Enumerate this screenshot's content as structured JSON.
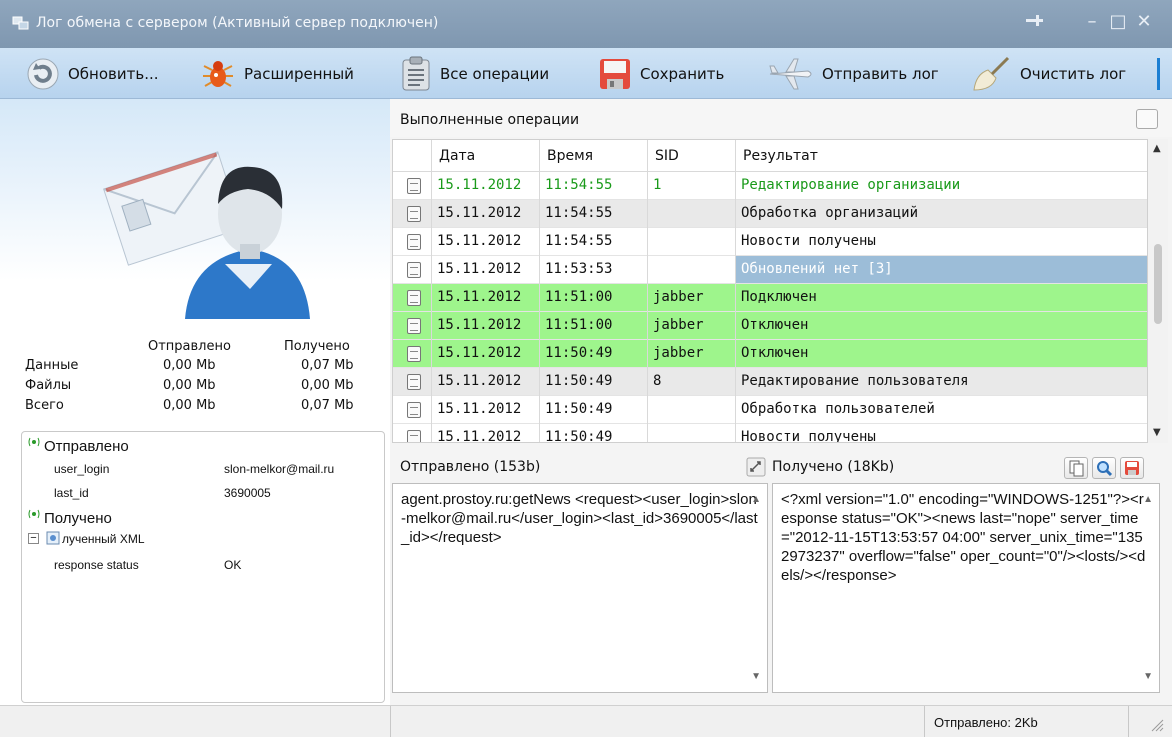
{
  "window": {
    "title": "Лог обмена с сервером (Активный сервер подключен)"
  },
  "toolbar": {
    "refresh": "Обновить...",
    "extended": "Расширенный",
    "all_ops": "Все операции",
    "save": "Сохранить",
    "send_log": "Отправить лог",
    "clear_log": "Очистить лог"
  },
  "stats": {
    "header_sent": "Отправлено",
    "header_received": "Получено",
    "rows": [
      {
        "label": "Данные",
        "sent": "0,00 Mb",
        "received": "0,07 Mb"
      },
      {
        "label": "Файлы",
        "sent": "0,00 Mb",
        "received": "0,00 Mb"
      },
      {
        "label": "Всего",
        "sent": "0,00 Mb",
        "received": "0,07 Mb"
      }
    ]
  },
  "tree": {
    "sent_label": "Отправлено",
    "sent_items": [
      {
        "key": "user_login",
        "value": "slon-melkor@mail.ru"
      },
      {
        "key": "last_id",
        "value": "3690005"
      }
    ],
    "received_label": "Получено",
    "received_xml": "лученный XML",
    "received_items": [
      {
        "key": "response status",
        "value": "OK"
      }
    ]
  },
  "ops": {
    "title": "Выполненные операции",
    "columns": [
      "Дата",
      "Время",
      "SID",
      "Результат"
    ],
    "rows": [
      {
        "date": "15.11.2012",
        "time": "11:54:55",
        "sid": "1",
        "result": "Редактирование организации",
        "style": "green-text"
      },
      {
        "date": "15.11.2012",
        "time": "11:54:55",
        "sid": "",
        "result": "Обработка организаций",
        "style": "gray"
      },
      {
        "date": "15.11.2012",
        "time": "11:54:55",
        "sid": "",
        "result": "Новости получены",
        "style": "white"
      },
      {
        "date": "15.11.2012",
        "time": "11:53:53",
        "sid": "",
        "result": "Обновлений нет [3]",
        "style": "selected"
      },
      {
        "date": "15.11.2012",
        "time": "11:51:00",
        "sid": "jabber",
        "result": "Подключен",
        "style": "green-bg"
      },
      {
        "date": "15.11.2012",
        "time": "11:51:00",
        "sid": "jabber",
        "result": "Отключен",
        "style": "green-bg"
      },
      {
        "date": "15.11.2012",
        "time": "11:50:49",
        "sid": "jabber",
        "result": "Отключен",
        "style": "green-bg"
      },
      {
        "date": "15.11.2012",
        "time": "11:50:49",
        "sid": "8",
        "result": "Редактирование пользователя",
        "style": "gray"
      },
      {
        "date": "15.11.2012",
        "time": "11:50:49",
        "sid": "",
        "result": "Обработка пользователей",
        "style": "white"
      },
      {
        "date": "15.11.2012",
        "time": "11:50:49",
        "sid": "",
        "result": "Новости получены",
        "style": "white"
      }
    ]
  },
  "sent_pane": {
    "label": "Отправлено (153b)",
    "text": "agent.prostoy.ru:getNews <request><user_login>slon-melkor@mail.ru</user_login><last_id>3690005</last_id></request>"
  },
  "received_pane": {
    "label": "Получено (18Kb)",
    "text": "<?xml version=\"1.0\" encoding=\"WINDOWS-1251\"?><response status=\"OK\"><news last=\"nope\" server_time=\"2012-11-15T13:53:57 04:00\" server_unix_time=\"1352973237\" overflow=\"false\" oper_count=\"0\"/><losts/><dels/></response>"
  },
  "status": {
    "sent": "Отправлено: 2Kb"
  },
  "colors": {
    "green_bg": "#9ef58c",
    "selected": "#9cbdd8",
    "green_text": "#1a9a1a",
    "gray_row": "#e9e9e9"
  }
}
